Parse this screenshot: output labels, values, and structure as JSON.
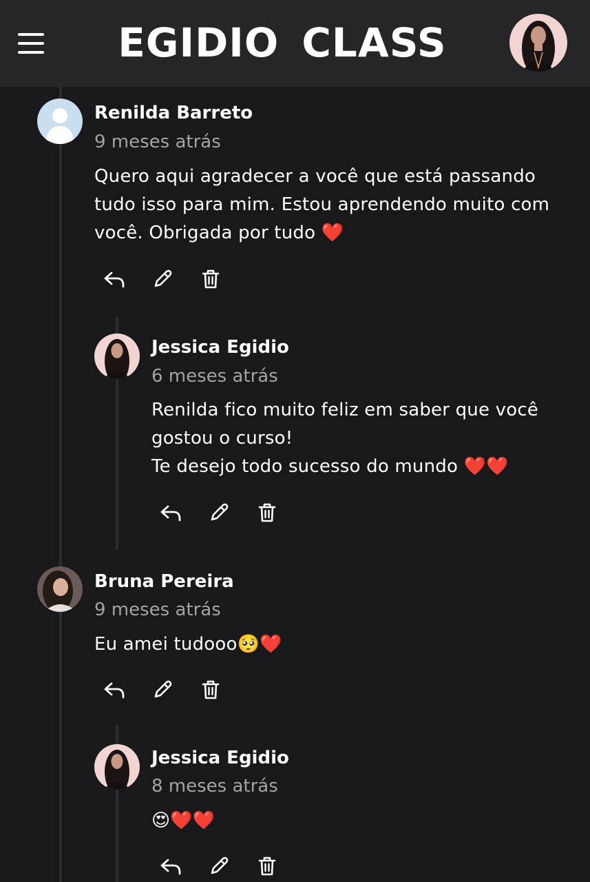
{
  "header": {
    "brand": "EGIDIO  CLASS",
    "menu_icon": "hamburger-menu-icon",
    "profile_avatar": "user-avatar"
  },
  "comments": [
    {
      "author": "Renilda Barreto",
      "time": "9 meses atrás",
      "body": "Quero aqui agradecer a você que está passando\ntudo isso para mim. Estou aprendendo muito com\nvocê. Obrigada por tudo ❤️",
      "avatar": "default-person-icon"
    },
    {
      "author": "Jessica Egidio",
      "time": "6 meses atrás",
      "body": "Renilda fico muito feliz em saber que você\ngostou o curso!\nTe desejo todo sucesso do mundo ❤️❤️",
      "avatar": "profile-photo"
    },
    {
      "author": "Bruna Pereira",
      "time": "9 meses atrás",
      "body": "Eu amei tudooo🥺❤️",
      "avatar": "profile-photo"
    },
    {
      "author": "Jessica Egidio",
      "time": "8 meses atrás",
      "body": "😍❤️❤️",
      "avatar": "profile-photo"
    }
  ],
  "actions": {
    "reply_icon": "reply-icon",
    "edit_icon": "pencil-icon",
    "delete_icon": "trash-icon"
  },
  "colors": {
    "background": "#19181b",
    "header": "#262628",
    "text": "#ffffff",
    "muted": "#a3a3a8",
    "thread_line": "#2d2c30"
  }
}
